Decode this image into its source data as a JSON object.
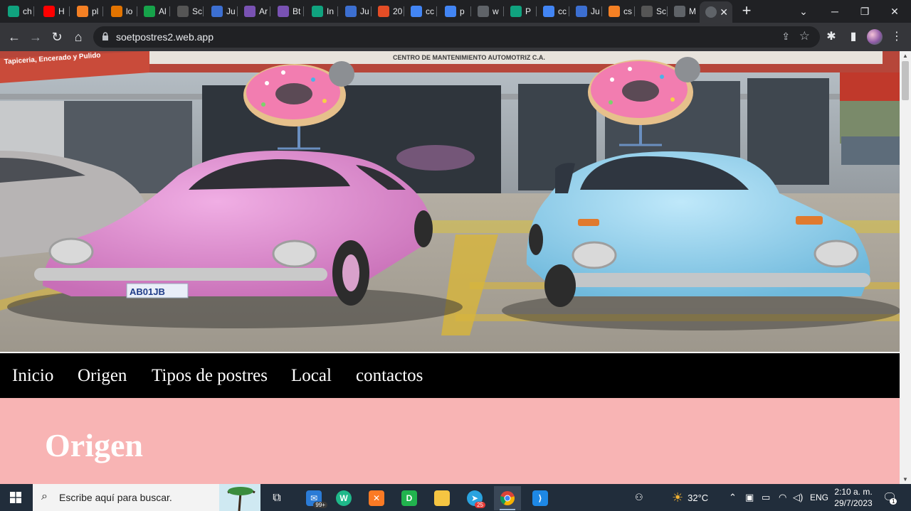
{
  "browser": {
    "tabs": [
      {
        "label": "ch",
        "icon": "chatgpt-icon",
        "color": "#10a37f"
      },
      {
        "label": "H",
        "icon": "youtube-icon",
        "color": "#ff0000"
      },
      {
        "label": "pl",
        "icon": "stack-icon",
        "color": "#f48024"
      },
      {
        "label": "lo",
        "icon": "mountain-icon",
        "color": "#e37400"
      },
      {
        "label": "Al",
        "icon": "green-app-icon",
        "color": "#16a34a"
      },
      {
        "label": "Sc",
        "icon": "soet-icon",
        "color": "#555555"
      },
      {
        "label": "Ju",
        "icon": "site-icon",
        "color": "#3c6fd1"
      },
      {
        "label": "Ar",
        "icon": "bootstrap-icon",
        "color": "#7952b3"
      },
      {
        "label": "Bt",
        "icon": "bootstrap-icon",
        "color": "#7952b3"
      },
      {
        "label": "In",
        "icon": "chatgpt-icon",
        "color": "#10a37f"
      },
      {
        "label": "Ju",
        "icon": "site-icon",
        "color": "#3c6fd1"
      },
      {
        "label": "20",
        "icon": "c-icon",
        "color": "#e44d26"
      },
      {
        "label": "cc",
        "icon": "google-icon",
        "color": "#4285f4"
      },
      {
        "label": "p",
        "icon": "google-icon",
        "color": "#4285f4"
      },
      {
        "label": "w",
        "icon": "globe-icon",
        "color": "#5f6368"
      },
      {
        "label": "P",
        "icon": "chatgpt-icon",
        "color": "#10a37f"
      },
      {
        "label": "cc",
        "icon": "google-icon",
        "color": "#4285f4"
      },
      {
        "label": "Ju",
        "icon": "site-icon",
        "color": "#3c6fd1"
      },
      {
        "label": "cs",
        "icon": "stack-icon",
        "color": "#f48024"
      },
      {
        "label": "Sc",
        "icon": "soet-icon",
        "color": "#555555"
      },
      {
        "label": "M",
        "icon": "globe-icon",
        "color": "#5f6368"
      }
    ],
    "active_tab": {
      "label": "",
      "close": "✕"
    },
    "new_tab": "+",
    "url": "soetpostres2.web.app",
    "window": {
      "minimize": "─",
      "maximize": "❐",
      "close": "✕",
      "dropdown": "⌄"
    }
  },
  "page": {
    "hero": {
      "sign_left": "Tapiceria, Encerado y Pulido",
      "sign_center": "CENTRO DE MANTENIMIENTO AUTOMOTRIZ C.A.",
      "plate": "AB01JB"
    },
    "nav": [
      "Inicio",
      "Origen",
      "Tipos de postres",
      "Local",
      "contactos"
    ],
    "section_title": "Origen"
  },
  "taskbar": {
    "search_placeholder": "Escribe aquí para buscar.",
    "mail_badge": "99+",
    "telegram_badge": "25",
    "weather": "32°C",
    "language": "ENG",
    "time": "2:10 a. m.",
    "date": "29/7/2023",
    "notifications": "1"
  },
  "colors": {
    "nav_bg": "#000000",
    "section_bg": "#f8b4b4",
    "pink_car": "#e591d6",
    "blue_car": "#9fd7f0",
    "donut": "#f27db0"
  }
}
